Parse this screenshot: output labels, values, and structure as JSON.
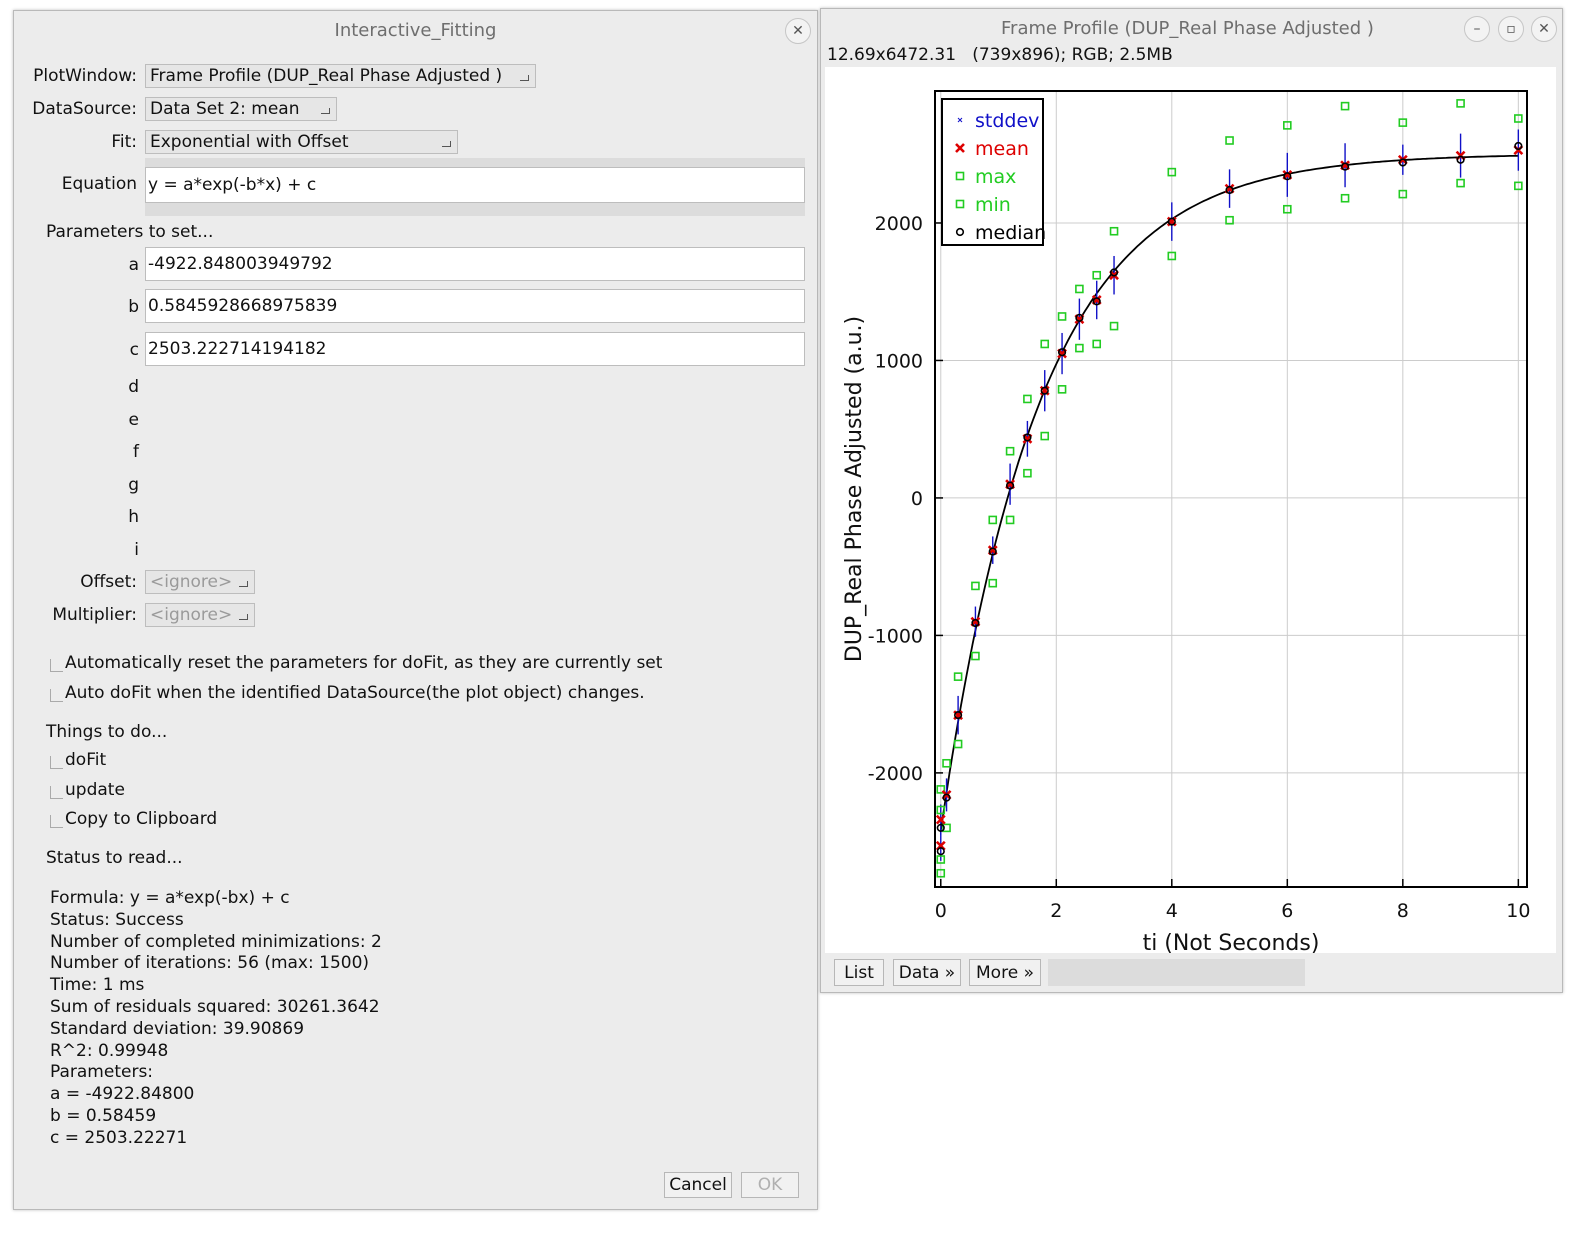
{
  "fit_window": {
    "title": "Interactive_Fitting",
    "plot_window_label": "PlotWindow:",
    "plot_window_value": "Frame Profile (DUP_Real Phase Adjusted )",
    "data_source_label": "DataSource:",
    "data_source_value": "Data Set 2: mean",
    "fit_label": "Fit:",
    "fit_value": "Exponential with Offset",
    "equation_label": "Equation",
    "equation_value": "y = a*exp(-b*x) + c",
    "params_heading": "Parameters to set...",
    "params": [
      {
        "name": "a",
        "value": "-4922.848003949792"
      },
      {
        "name": "b",
        "value": "0.5845928668975839"
      },
      {
        "name": "c",
        "value": "2503.222714194182"
      },
      {
        "name": "d",
        "value": ""
      },
      {
        "name": "e",
        "value": ""
      },
      {
        "name": "f",
        "value": ""
      },
      {
        "name": "g",
        "value": ""
      },
      {
        "name": "h",
        "value": ""
      },
      {
        "name": "i",
        "value": ""
      }
    ],
    "offset_label": "Offset:",
    "offset_value": "<ignore>",
    "multiplier_label": "Multiplier:",
    "multiplier_value": "<ignore>",
    "auto_reset_label": "Automatically reset the parameters for doFit, as they are currently set",
    "auto_dofit_label": "Auto doFit when the identified DataSource(the plot object) changes.",
    "things_heading": "Things to do...",
    "dofit_label": "doFit",
    "update_label": "update",
    "copy_label": "Copy to Clipboard",
    "status_heading": "Status to read...",
    "status_lines": [
      "Formula: y = a*exp(-bx) + c",
      "Status: Success",
      "Number of completed minimizations: 2",
      "Number of iterations: 56 (max: 1500)",
      "Time: 1 ms",
      "Sum of residuals squared: 30261.3642",
      "Standard deviation: 39.90869",
      "R^2: 0.99948",
      "Parameters:",
      "a = -4922.84800",
      "b = 0.58459",
      "c = 2503.22271"
    ],
    "cancel_label": "Cancel",
    "ok_label": "OK"
  },
  "plot_window": {
    "title": "Frame Profile (DUP_Real Phase Adjusted )",
    "info": "12.69x6472.31   (739x896); RGB; 2.5MB",
    "list_button": "List",
    "data_button": "Data »",
    "more_button": "More »"
  },
  "chart_data": {
    "type": "scatter",
    "xlabel": "ti (Not Seconds)",
    "ylabel": "DUP_Real Phase Adjusted  (a.u.)",
    "xlim": [
      -0.1,
      10.15
    ],
    "ylim": [
      -2830,
      2960
    ],
    "xticks": [
      0,
      2,
      4,
      6,
      8,
      10
    ],
    "yticks": [
      -2000,
      -1000,
      0,
      1000,
      2000
    ],
    "grid": true,
    "legend_position": "top-left",
    "colors": {
      "stddev": "#1010c8",
      "mean": "#dd0000",
      "max": "#22cc22",
      "min": "#22cc22",
      "median": "#000000",
      "fit": "#000000"
    },
    "fit": {
      "a": -4922.848,
      "b": 0.58459,
      "c": 2503.2227
    },
    "legend": [
      "stddev",
      "mean",
      "max",
      "min",
      "median"
    ],
    "x": [
      0,
      0,
      0.1,
      0.3,
      0.6,
      0.9,
      1.2,
      1.5,
      1.8,
      2.1,
      2.4,
      2.7,
      3,
      4,
      5,
      6,
      7,
      8,
      9,
      10
    ],
    "series": [
      {
        "name": "mean",
        "values": [
          -2530,
          -2340,
          -2160,
          -1580,
          -900,
          -380,
          100,
          430,
          780,
          1050,
          1300,
          1440,
          1620,
          2010,
          2250,
          2350,
          2420,
          2460,
          2490,
          2530
        ]
      },
      {
        "name": "median",
        "values": [
          -2570,
          -2400,
          -2180,
          -1580,
          -910,
          -390,
          90,
          440,
          780,
          1060,
          1310,
          1430,
          1640,
          2010,
          2240,
          2340,
          2410,
          2440,
          2460,
          2560
        ]
      },
      {
        "name": "max",
        "values": [
          -2120,
          -2270,
          -1930,
          -1300,
          -640,
          -160,
          340,
          720,
          1120,
          1320,
          1520,
          1620,
          1940,
          2370,
          2600,
          2710,
          2850,
          2730,
          2870,
          2760
        ]
      },
      {
        "name": "min",
        "values": [
          -2730,
          -2630,
          -2400,
          -1790,
          -1150,
          -620,
          -160,
          180,
          450,
          790,
          1090,
          1120,
          1250,
          1760,
          2020,
          2100,
          2180,
          2210,
          2290,
          2270
        ]
      },
      {
        "name": "stddev",
        "values": [
          110,
          110,
          120,
          140,
          110,
          100,
          150,
          130,
          150,
          150,
          150,
          140,
          140,
          140,
          140,
          160,
          160,
          110,
          160,
          150
        ]
      }
    ]
  }
}
